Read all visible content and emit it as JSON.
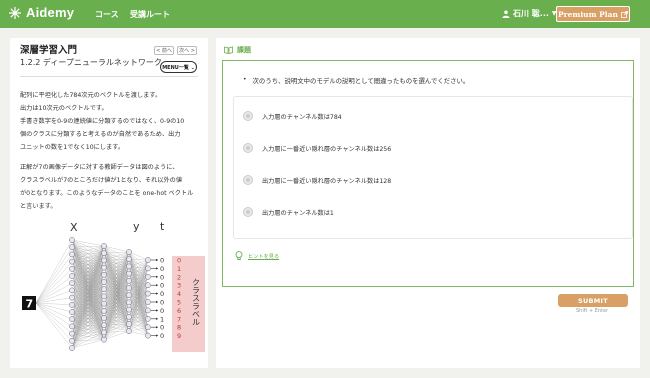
{
  "header": {
    "brand": "Aidemy",
    "nav": [
      "コース",
      "受講ルート"
    ],
    "user_name": "石川 聡...",
    "premium_label": "Premium Plan",
    "bg_color": "#6aaf4e",
    "premium_color": "#d9a066"
  },
  "left": {
    "title": "深層学習入門",
    "prev_label": "< 前へ",
    "next_label": "次へ >",
    "section": "1.2.2 ディープニューラルネットワーク",
    "menu_label": "MENU一覧 ⌄",
    "para1": [
      "配列に平坦化した784次元のベクトルを渡します。",
      "出力は10次元のベクトルです。",
      "手書き数字を0-9の連続値に分類するのではなく、0-9の10",
      "個のクラスに分類すると考えるのが自然であるため、出力",
      "ユニットの数を1でなく10にします。"
    ],
    "para2": [
      "正解が7の画像データに対する教師データは図のように、",
      "クラスラベルが7のところだけ値が1となり、それ以外の値",
      "が0となります。このようなデータのことを one-hot ベクトル",
      "と言います。"
    ],
    "figure": {
      "labels": {
        "x": "X",
        "y": "y",
        "t": "t"
      },
      "input_digit": "7",
      "t_values": [
        "0",
        "0",
        "0",
        "0",
        "0",
        "0",
        "0",
        "1",
        "0",
        "0"
      ],
      "class_digits": [
        "0",
        "1",
        "2",
        "3",
        "4",
        "5",
        "6",
        "7",
        "8",
        "9"
      ],
      "class_label": "クラスラベル"
    }
  },
  "task": {
    "heading": "課題",
    "question": "次のうち、説明文中のモデルの説明として間違ったものを選んでください。",
    "options": [
      "入力層のチャンネル数は784",
      "入力層に一番近い隠れ層のチャンネル数は256",
      "出力層に一番近い隠れ層のチャンネル数は128",
      "出力層のチャンネル数は1"
    ],
    "hint_label": "ヒントを見る",
    "submit_label": "SUBMIT",
    "shortcut": "Shift + Enter",
    "accent_color": "#6aaf4e"
  }
}
